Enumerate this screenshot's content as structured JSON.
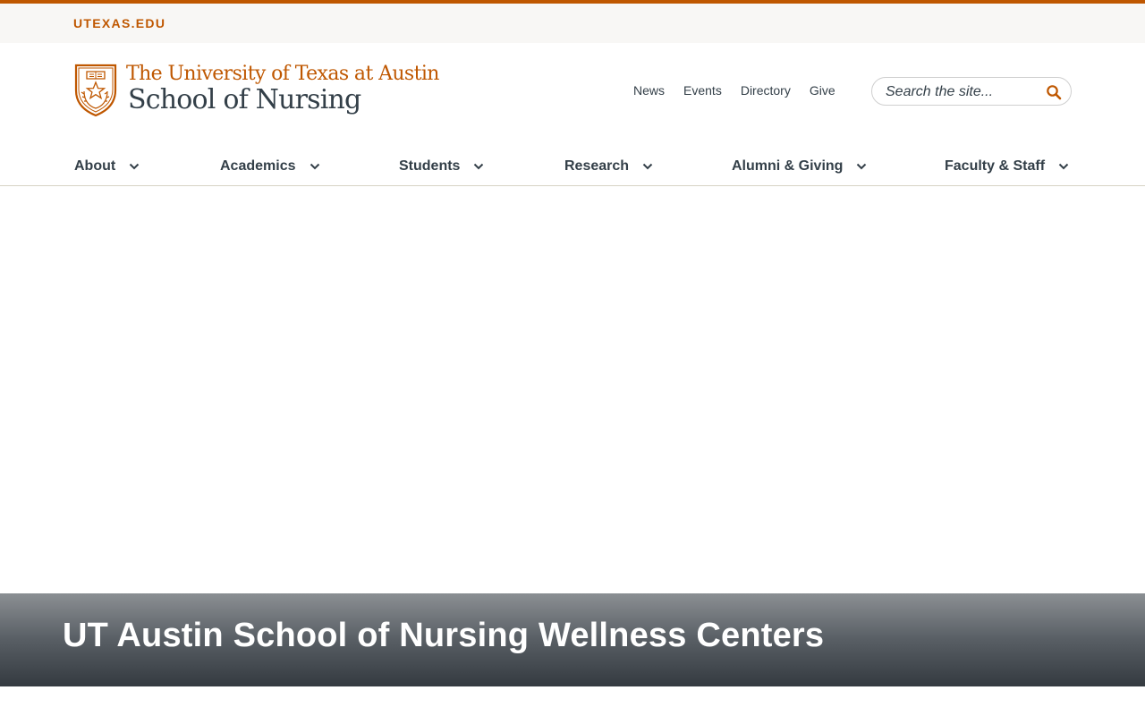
{
  "utility": {
    "link": "UTEXAS.EDU"
  },
  "logo": {
    "line1": "The University of Texas at Austin",
    "line2": "School of Nursing"
  },
  "quick_links": [
    "News",
    "Events",
    "Directory",
    "Give"
  ],
  "search": {
    "placeholder": "Search the site...",
    "icon": "search-icon"
  },
  "nav": [
    "About",
    "Academics",
    "Students",
    "Research",
    "Alumni & Giving",
    "Faculty & Staff"
  ],
  "hero": {
    "title": "UT Austin School of Nursing Wellness Centers"
  },
  "colors": {
    "brand": "#bf5700",
    "text": "#333f48",
    "utility_bg": "#f8f7f5"
  }
}
